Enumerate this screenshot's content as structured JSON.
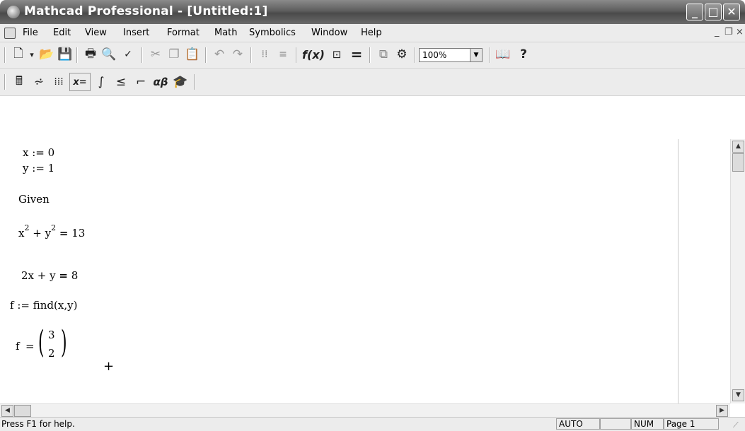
{
  "window": {
    "title": "Mathcad Professional - [Untitled:1]",
    "controls": {
      "minimize": "_",
      "maximize": "□",
      "close": "✕"
    }
  },
  "menubar": {
    "items": [
      "File",
      "Edit",
      "View",
      "Insert",
      "Format",
      "Math",
      "Symbolics",
      "Window",
      "Help"
    ],
    "mdi": {
      "minimize": "_",
      "restore": "❐",
      "close": "×"
    }
  },
  "toolbar_standard": {
    "zoom": "100%",
    "icons": [
      "new-document-icon",
      "dropdown-arrow-icon",
      "open-folder-icon",
      "save-icon",
      "print-icon",
      "print-preview-icon",
      "spellcheck-icon",
      "cut-icon",
      "copy-icon",
      "paste-icon",
      "undo-icon",
      "redo-icon",
      "align-across-icon",
      "align-down-icon",
      "insert-function-icon",
      "insert-unit-icon",
      "calculate-icon",
      "component-icon",
      "resource-icon",
      "resource-center-icon",
      "help-icon"
    ]
  },
  "toolbar_math": {
    "icons": [
      "calculator-toolbar-icon",
      "graph-toolbar-icon",
      "matrix-toolbar-icon",
      "evaluation-toolbar-icon",
      "calculus-toolbar-icon",
      "boolean-toolbar-icon",
      "programming-toolbar-icon",
      "greek-toolbar-icon",
      "symbolic-toolbar-icon"
    ],
    "evaluation_label": "x=",
    "greek_label": "αβ"
  },
  "worksheet": {
    "assign_x": {
      "lhs": "x",
      "op": ":=",
      "rhs": "0"
    },
    "assign_y": {
      "lhs": "y",
      "op": ":=",
      "rhs": "1"
    },
    "given": "Given",
    "eq1": {
      "a": "x",
      "a_exp": "2",
      "plus": "+",
      "b": "y",
      "b_exp": "2",
      "eq": "=",
      "rhs": "13"
    },
    "eq2": {
      "lhs": "2x + y",
      "eq": "=",
      "rhs": "8"
    },
    "find": {
      "lhs": "f",
      "op": ":=",
      "rhs": "find(x,y)"
    },
    "result": {
      "lhs": "f",
      "eq": "=",
      "values": [
        "3",
        "2"
      ]
    },
    "cursor": "+"
  },
  "statusbar": {
    "help_text": "Press F1 for help.",
    "mode": "AUTO",
    "caps": "",
    "num": "NUM",
    "page": "Page 1"
  }
}
